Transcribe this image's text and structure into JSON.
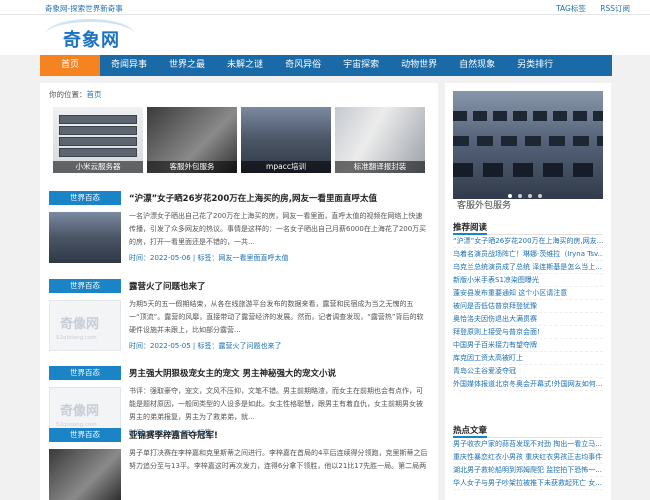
{
  "topbar": {
    "tagline": "奇象网-探索世界新奇事",
    "links": [
      "TAG标签",
      "RSS订阅"
    ]
  },
  "logo": {
    "text": "奇象网"
  },
  "nav": {
    "items": [
      "首页",
      "奇闻异事",
      "世界之最",
      "未解之谜",
      "奇风异俗",
      "宇宙探索",
      "动物世界",
      "自然现象",
      "另类排行"
    ]
  },
  "breadcrumb": {
    "prefix": "你的位置：",
    "home": "首页"
  },
  "thumbs": [
    {
      "caption": "小米云服务器"
    },
    {
      "caption": "客服外包服务"
    },
    {
      "caption": "mpacc培训"
    },
    {
      "caption": "标准翻译报封装"
    }
  ],
  "articles": [
    {
      "category": "世界百态",
      "title": "“沪漂”女子晒26岁花200万在上海买的房,网友一看里面直呼太值",
      "summary": "一名沪漂女子晒出自己花了200万在上海买的房，网友一看里面，直呼太值的视频在网络上快速传播，引发了众多网友的热议。事情是这样的：一名女子晒出自己月薪6000在上海花了200万买的房，打开一看里面还是不错的，一共...",
      "date": "时间：2022-05-06",
      "tag": "标签：网友一看里面直呼太值"
    },
    {
      "category": "世界百态",
      "title": "露营火了问题也来了",
      "summary": "为期5天的五一假期结束，从各在线旅游平台发布的数据来看，露营和民宿成为当之无愧的五一“顶流”。露营的风靡，直接带动了露营经济的发展。然而，记者调查发现，“露营热”背后的软硬件设施并未跟上，比如部分露营...",
      "date": "时间：2022-05-05",
      "tag": "标签：露营火了问题也来了"
    },
    {
      "category": "世界百态",
      "title": "男主强大阴狠极宠女主的宠文 男主神秘强大的宠文小说",
      "summary": "书评：强取豪夺，宠文，文风不压抑，文笔不错。男主前期略渣，而女主在前期也会有点作，可能是题材原因，一般同类型的人设多是如此。女主性格聪慧，跟男主有着血仇，女主前期男女被男主的弟弟报复，男主为了救弟弟，就...",
      "date": "时间：2022-05-03",
      "tag": "标签："
    },
    {
      "category": "世界百态",
      "title": "亚锦赛李梓嘉首夺冠军!",
      "summary": "男子单打决赛在李梓嘉和克里斯蒂之间进行。李梓嘉在首局的4平后连续得分领跑，克里斯蒂之后努力追分至与13平。李梓嘉这时再次发力，连得6分拿下领胜，他以21比17先胜一局。第二局两",
      "date": "",
      "tag": ""
    }
  ],
  "placeholder": {
    "logo": "奇像网",
    "url": "52qixiang.com"
  },
  "sidebar": {
    "slide_caption": "客服外包服务",
    "recommend": {
      "title": "推荐阅读",
      "links": [
        "“沪漂”女子晒26岁花200万在上海买的房,网友...",
        "乌着名演员战场阵亡！琳娜·茨维拉（Iryna Tsv...",
        "乌克兰总统演员成了总统 泽连斯基是怎么当上...",
        "新版小米手表S1凉染图曝光",
        "蓬安县发布重要通知 这个小区请注意",
        "被问是否低估普京拜登犹豫",
        "奥恰洛夫因伤退出大满贯赛",
        "拜登原则上接受与普京会面!",
        "中国男子百米接力有望夺牌",
        "库克因工资太高被盯上",
        "青岛公主谷爱凌夺冠",
        "外国媒体报道北京冬奥会开幕式!外国网友如何..."
      ]
    },
    "hot": {
      "title": "热点文章",
      "links": [
        "男子收农户家的蒜苔发现不对劲 掏出一看立马...",
        "重庆性暴恋红衣小男孩 重庆红衣男孩正志均事件",
        "湖北男子救轮船明到郑姆爬犯 监控拍下恐怖一...",
        "华人女子与男子吵架拉被推下未获救起死亡 女..."
      ]
    }
  }
}
